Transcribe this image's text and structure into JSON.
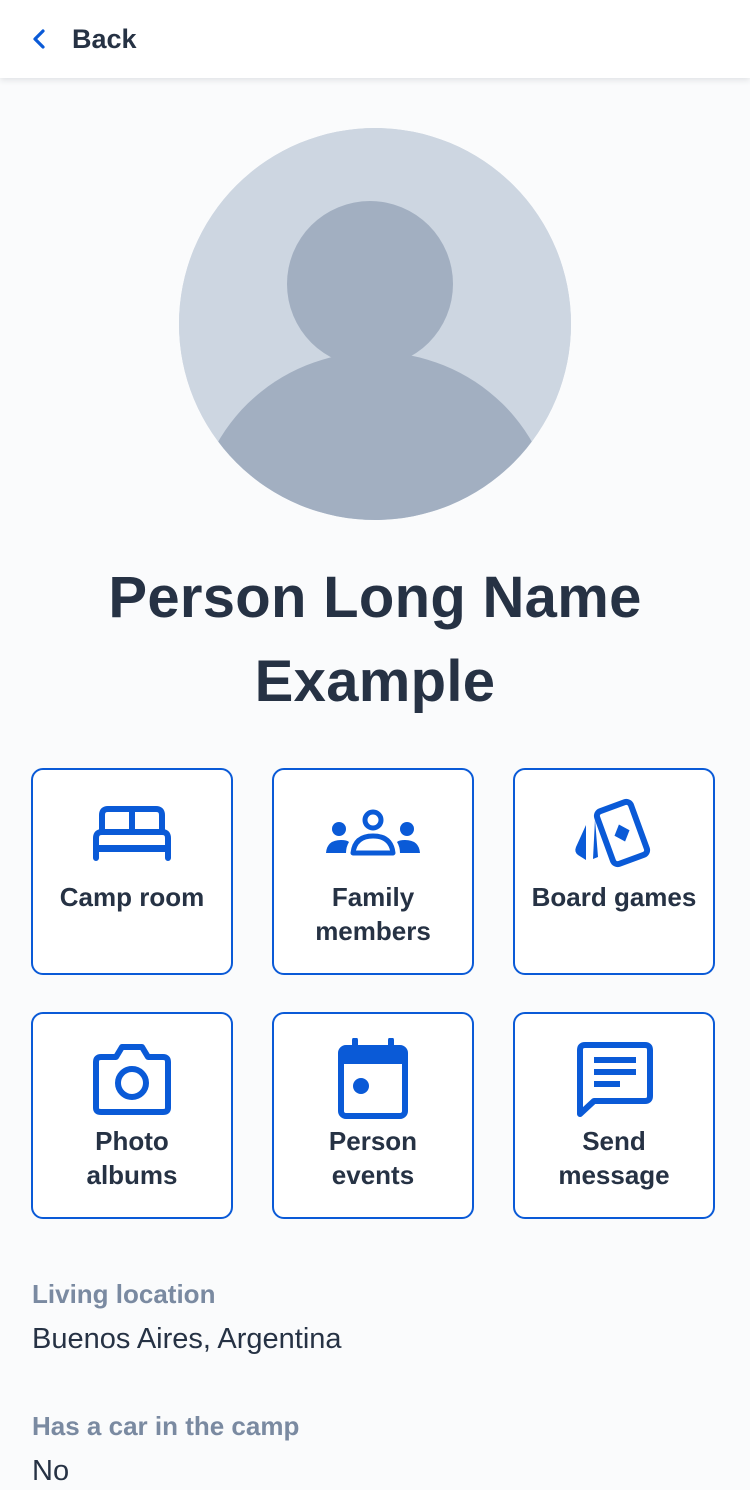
{
  "header": {
    "back_label": "Back"
  },
  "profile": {
    "name": "Person Long Name Example",
    "avatar_colors": {
      "background": "#cdd6e1",
      "figure": "#a2afc1"
    }
  },
  "actions": [
    {
      "label": "Camp room",
      "icon": "bed-icon"
    },
    {
      "label": "Family members",
      "icon": "group-icon"
    },
    {
      "label": "Board games",
      "icon": "playing-cards-icon"
    },
    {
      "label": "Photo albums",
      "icon": "camera-icon"
    },
    {
      "label": "Person events",
      "icon": "calendar-icon"
    },
    {
      "label": "Send message",
      "icon": "message-icon"
    }
  ],
  "details": [
    {
      "label": "Living location",
      "value": "Buenos Aires, Argentina"
    },
    {
      "label": "Has a car in the camp",
      "value": "No"
    }
  ],
  "colors": {
    "accent": "#0a5ad7",
    "text": "#263244",
    "muted_label": "#7a8aa1"
  }
}
